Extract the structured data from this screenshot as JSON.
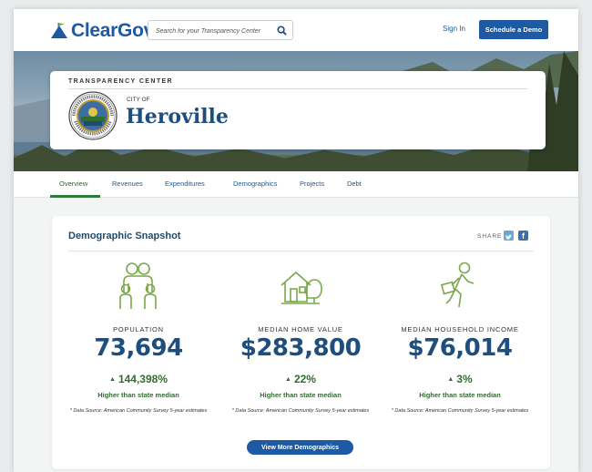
{
  "header": {
    "logo_text": "ClearGov",
    "search_placeholder": "Search for your Transparency Center",
    "sign_in": "Sign In",
    "demo_button": "Schedule a Demo"
  },
  "hero": {
    "section_label": "TRANSPARENCY CENTER",
    "city_prefix": "CITY OF",
    "city_name": "Heroville"
  },
  "tabs": [
    {
      "label": "Overview",
      "active": true
    },
    {
      "label": "Revenues"
    },
    {
      "label": "Expenditures"
    },
    {
      "label": "Demographics"
    },
    {
      "label": "Projects"
    },
    {
      "label": "Debt"
    }
  ],
  "snapshot": {
    "title": "Demographic Snapshot",
    "share_label": "SHARE",
    "stats": [
      {
        "icon": "family-icon",
        "label": "POPULATION",
        "value": "73,694",
        "change": "144,398%",
        "comparison": "Higher than state median",
        "source": "* Data Source: American Community Survey 5-year estimates"
      },
      {
        "icon": "house-icon",
        "label": "MEDIAN HOME VALUE",
        "value": "$283,800",
        "change": "22%",
        "comparison": "Higher than state median",
        "source": "* Data Source: American Community Survey 5-year estimates"
      },
      {
        "icon": "worker-icon",
        "label": "MEDIAN HOUSEHOLD INCOME",
        "value": "$76,014",
        "change": "3%",
        "comparison": "Higher than state median",
        "source": "* Data Source: American Community Survey 5-year estimates"
      }
    ],
    "more_button": "View More Demographics"
  },
  "colors": {
    "brand_blue": "#1d5aa3",
    "value_navy": "#1d4e7d",
    "positive_green": "#2f6e2e",
    "icon_green": "#7aa84a"
  }
}
